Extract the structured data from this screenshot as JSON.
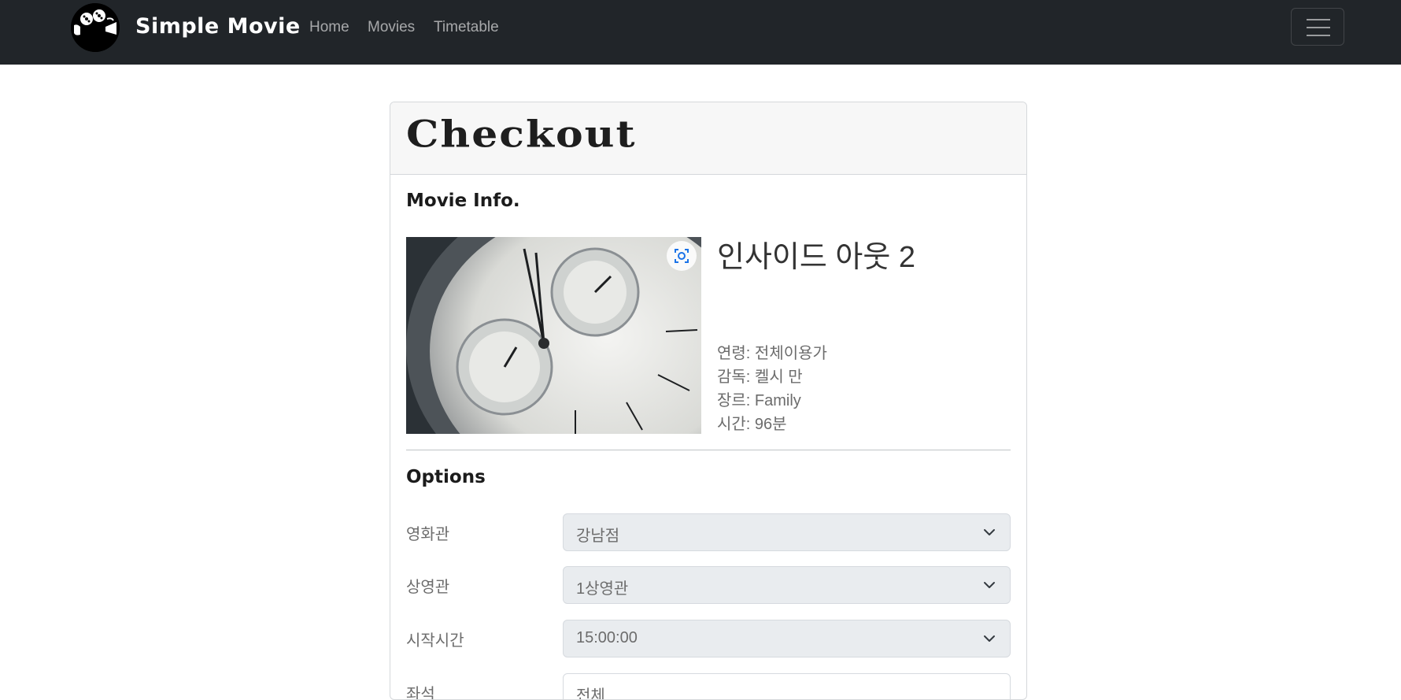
{
  "navbar": {
    "brand": "Simple Movie",
    "links": [
      {
        "label": "Home"
      },
      {
        "label": "Movies"
      },
      {
        "label": "Timetable"
      }
    ]
  },
  "checkout": {
    "title": "Checkout",
    "movie_info_heading": "Movie Info.",
    "movie": {
      "title": "인사이드 아웃 2",
      "age": "연령: 전체이용가",
      "director": "감독: 켈시 만",
      "genre": "장르: Family",
      "runtime": "시간: 96분"
    },
    "options_heading": "Options",
    "options": [
      {
        "label": "영화관",
        "value": "강남점"
      },
      {
        "label": "상영관",
        "value": "1상영관"
      },
      {
        "label": "시작시간",
        "value": "15:00:00"
      },
      {
        "label": "좌석",
        "value": "전체"
      }
    ]
  },
  "colors": {
    "navbar_bg": "#212529",
    "card_header_bg": "#f7f7f7",
    "select_bg": "#e9ecef"
  }
}
